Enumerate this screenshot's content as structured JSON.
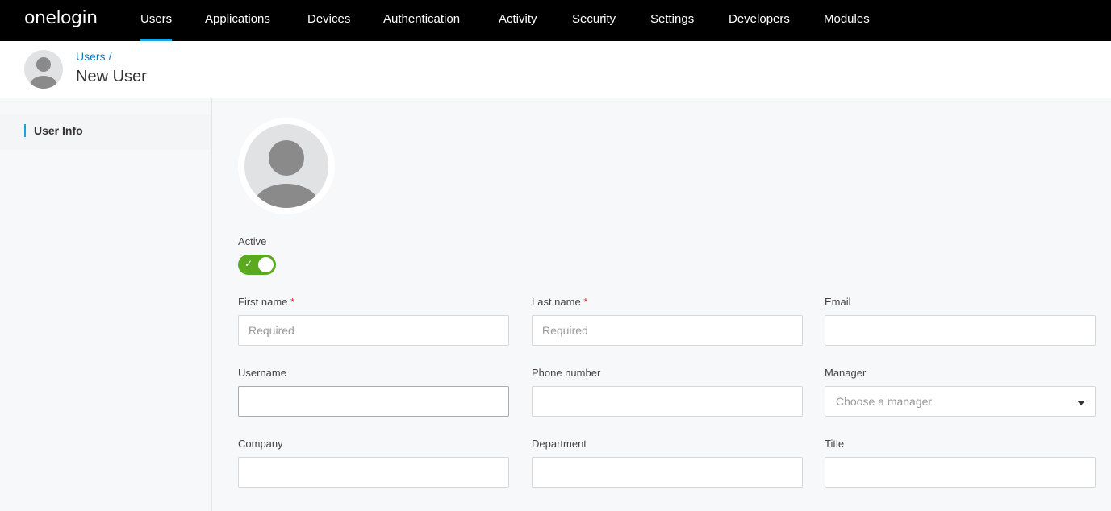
{
  "nav": {
    "logo": "onelogin",
    "items": [
      {
        "label": "Users"
      },
      {
        "label": "Applications"
      },
      {
        "label": "Devices"
      },
      {
        "label": "Authentication"
      },
      {
        "label": "Activity"
      },
      {
        "label": "Security"
      },
      {
        "label": "Settings"
      },
      {
        "label": "Developers"
      },
      {
        "label": "Modules"
      }
    ],
    "active": "Users"
  },
  "header": {
    "breadcrumb": "Users",
    "breadcrumb_sep": "/",
    "title": "New User"
  },
  "sidebar": {
    "items": [
      {
        "label": "User Info",
        "active": true
      }
    ]
  },
  "form": {
    "active_label": "Active",
    "active_on": true,
    "first_name": {
      "label": "First name",
      "required_mark": "*",
      "placeholder": "Required",
      "value": ""
    },
    "last_name": {
      "label": "Last name",
      "required_mark": "*",
      "placeholder": "Required",
      "value": ""
    },
    "email": {
      "label": "Email",
      "value": ""
    },
    "username": {
      "label": "Username",
      "value": ""
    },
    "phone": {
      "label": "Phone number",
      "value": ""
    },
    "manager": {
      "label": "Manager",
      "placeholder": "Choose a manager"
    },
    "company": {
      "label": "Company",
      "value": ""
    },
    "department": {
      "label": "Department",
      "value": ""
    },
    "title": {
      "label": "Title",
      "value": ""
    }
  },
  "colors": {
    "nav_bg": "#000000",
    "accent": "#1aa3e0",
    "toggle_on": "#5aa91f",
    "link": "#1877b5",
    "required": "#d62b2b"
  }
}
